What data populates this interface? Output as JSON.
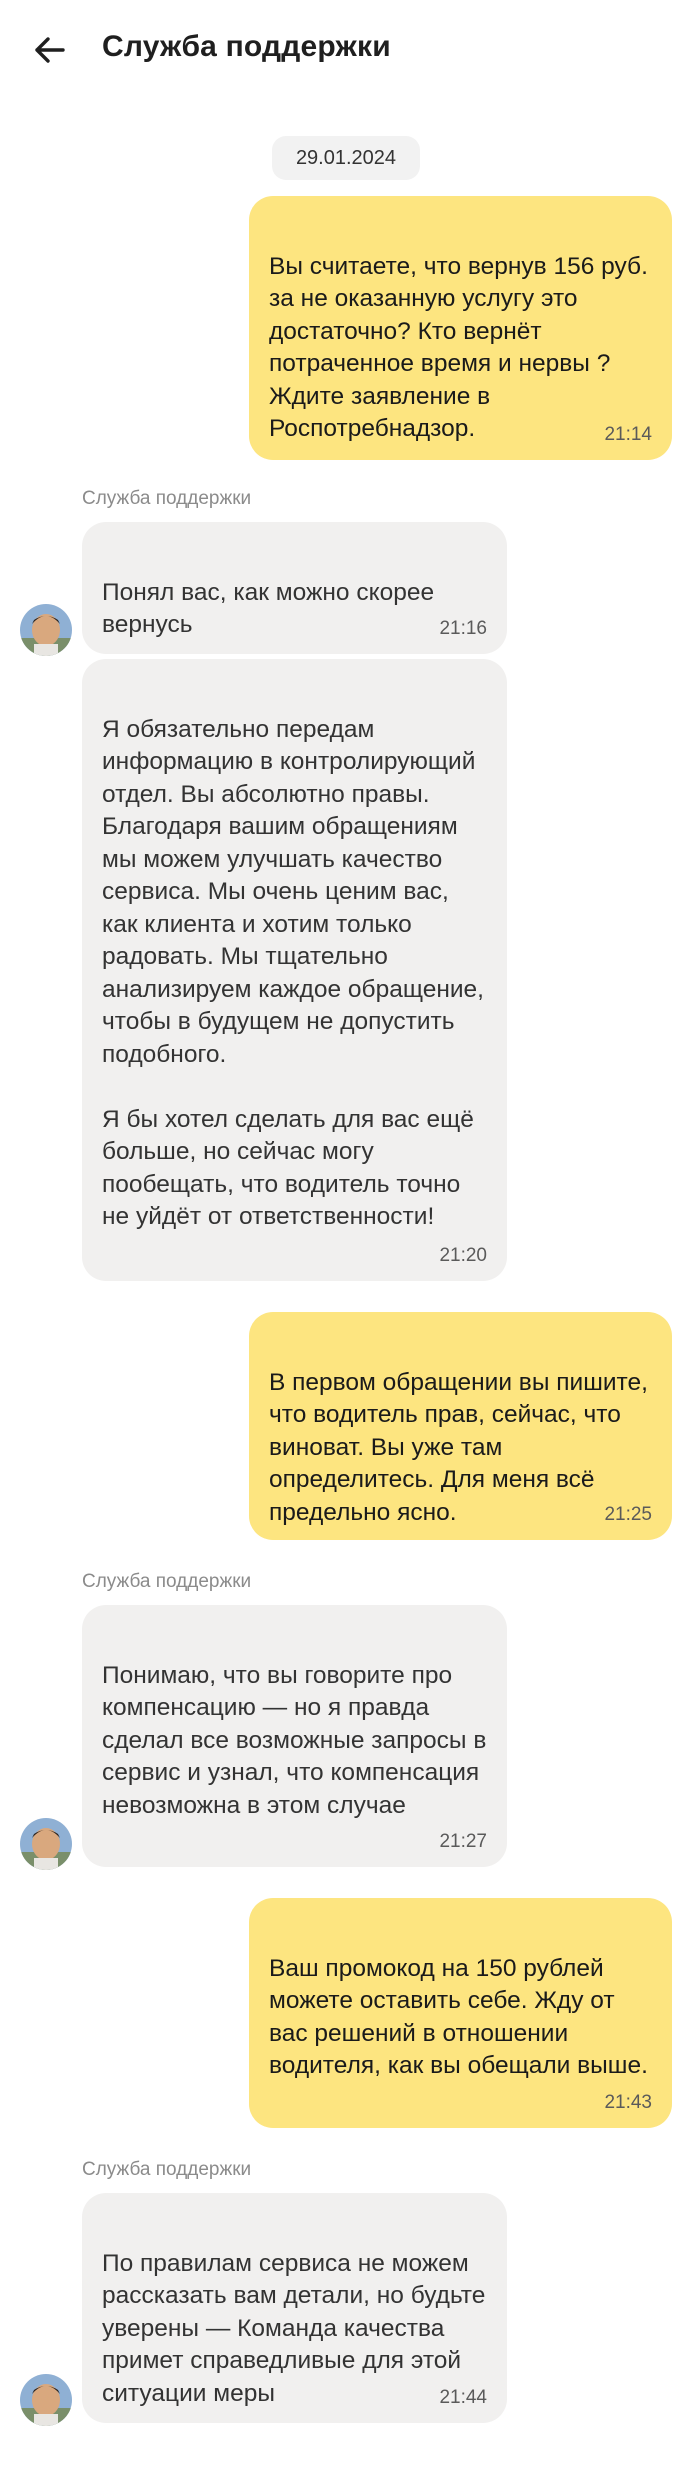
{
  "header": {
    "back_icon": "arrow-left-icon",
    "title": "Служба поддержки"
  },
  "chat": {
    "date_divider": "29.01.2024",
    "messages": [
      {
        "side": "out",
        "text": "Вы считаете, что вернув 156 руб. за не оказанную услугу это достаточно? Кто вернёт потраченное время и нервы ? Ждите заявление в Роспотребнадзор.",
        "time": "21:14"
      },
      {
        "side": "in",
        "sender": "Служба поддержки",
        "text": "Понял вас, как можно скорее вернусь",
        "time": "21:16"
      },
      {
        "side": "in",
        "text": "Я обязательно передам информацию в контролирующий отдел. Вы абсолютно правы. Благодаря вашим обращениям мы можем улучшать качество сервиса. Мы очень ценим вас, как клиента и хотим только радовать. Мы тщательно анализируем каждое обращение, чтобы в будущем не допустить подобного.\n\nЯ бы хотел сделать для вас ещё больше, но сейчас могу пообещать, что водитель точно не уйдёт от ответственности!",
        "time": "21:20"
      },
      {
        "side": "out",
        "text": "В первом обращении вы пишите, что водитель прав, сейчас, что виноват. Вы уже там определитесь. Для меня всё предельно ясно.",
        "time": "21:25"
      },
      {
        "side": "in",
        "sender": "Служба поддержки",
        "text": "Понимаю, что вы говорите про компенсацию — но я правда сделал все возможные запросы в сервис и узнал, что компенсация невозможна в этом случае",
        "time": "21:27"
      },
      {
        "side": "out",
        "text": "Ваш промокод на 150 рублей можете оставить себе. Жду от вас решений в отношении водителя, как вы обещали выше.",
        "time": "21:43"
      },
      {
        "side": "in",
        "sender": "Служба поддержки",
        "text": "По правилам сервиса не можем рассказать вам детали, но будьте уверены — Команда качества примет справедливые для этой ситуации меры",
        "time": "21:44"
      }
    ]
  },
  "colors": {
    "outgoing_bubble": "#fde580",
    "incoming_bubble": "#f1f0ef",
    "date_pill": "#f2f2f2"
  },
  "icons": {
    "avatar": "agent-avatar"
  }
}
